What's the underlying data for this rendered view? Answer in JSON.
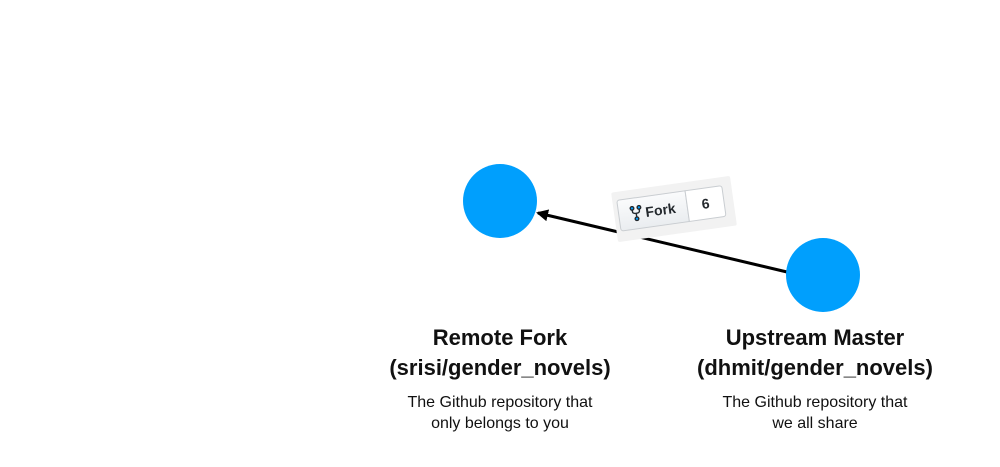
{
  "nodes": {
    "remote": {
      "title_line1": "Remote Fork",
      "title_line2": "(srisi/gender_novels)",
      "desc_line1": "The Github repository that",
      "desc_line2": "only belongs to you"
    },
    "upstream": {
      "title_line1": "Upstream Master",
      "title_line2": "(dhmit/gender_novels)",
      "desc_line1": "The Github repository that",
      "desc_line2": "we all share"
    }
  },
  "fork_badge": {
    "label": "Fork",
    "count": "6",
    "icon": "repo-forked-icon"
  },
  "colors": {
    "node_fill": "#009ffd",
    "arrow": "#000000"
  }
}
